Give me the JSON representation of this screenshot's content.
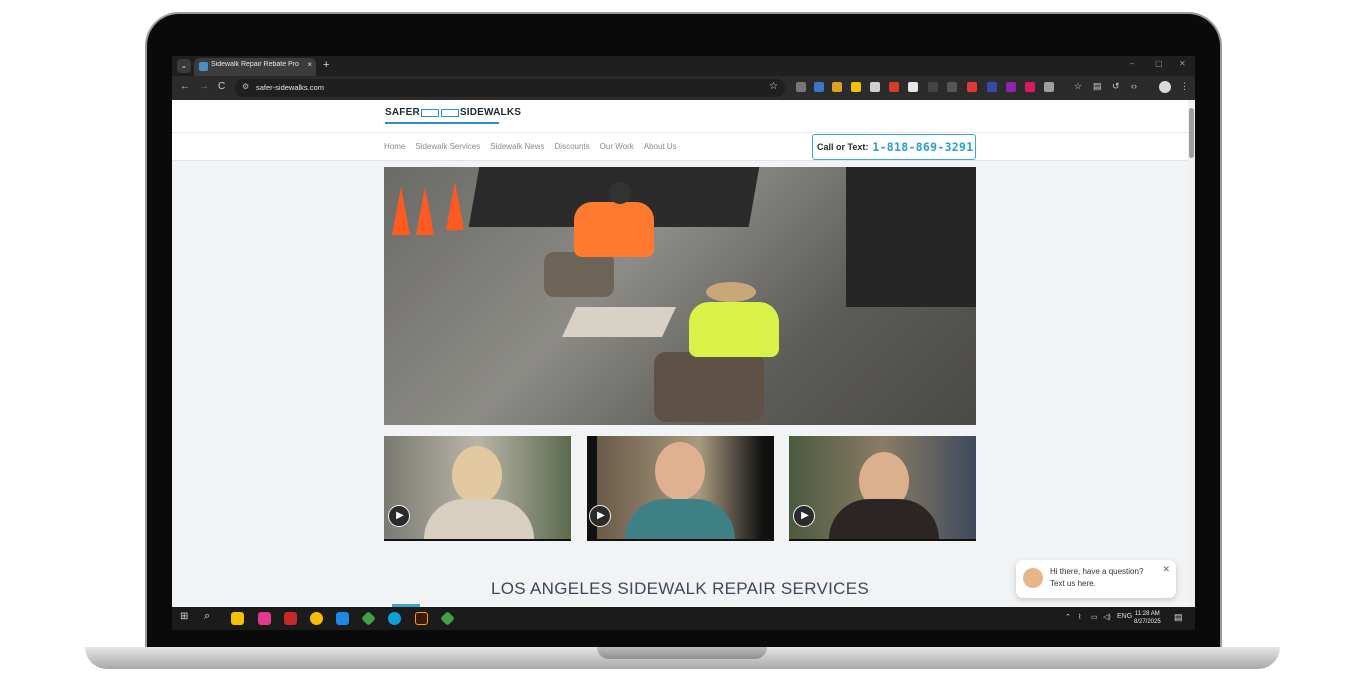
{
  "browser": {
    "tab_title": "Sidewalk Repair Rebate Progra...",
    "tab_close": "×",
    "new_tab": "+",
    "tab_menu": "⌄",
    "url": "safer-sidewalks.com",
    "window_controls": {
      "minimize": "–",
      "restore": "▢",
      "close": "✕"
    },
    "nav": {
      "back": "←",
      "forward": "→",
      "reload": "C"
    }
  },
  "site": {
    "logo": {
      "left": "SAFER",
      "right": "SIDEWALKS"
    },
    "nav_items": [
      {
        "label": "Home"
      },
      {
        "label": "Sidewalk Services"
      },
      {
        "label": "Sidewalk News"
      },
      {
        "label": "Discounts"
      },
      {
        "label": "Our Work"
      },
      {
        "label": "About Us"
      }
    ],
    "call": {
      "label": "Call or Text:",
      "phone": "1-818-869-3291"
    },
    "section_title": "LOS ANGELES SIDEWALK REPAIR SERVICES",
    "play_icon": "▶"
  },
  "chat": {
    "line1": "Hi there, have a question?",
    "line2": "Text us here.",
    "close": "✕",
    "button_icon": "✎"
  },
  "taskbar": {
    "lang": "ENG",
    "time": "11:28 AM",
    "date": "8/27/2025"
  },
  "colors": {
    "accent": "#2aa0c7",
    "chat_button": "#1976d2",
    "title": "#3a4a5c"
  }
}
